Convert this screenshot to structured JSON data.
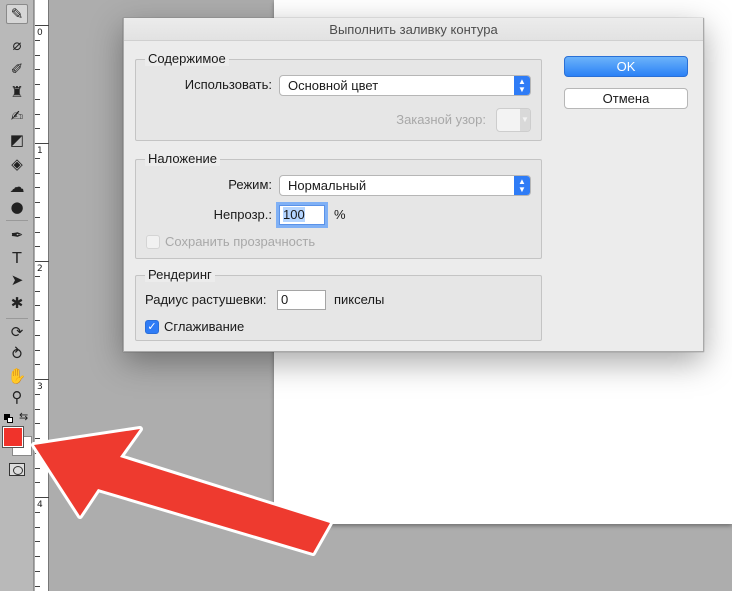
{
  "dialog": {
    "title": "Выполнить заливку контура",
    "content_group": {
      "legend": "Содержимое",
      "use_label": "Использовать:",
      "use_value": "Основной цвет",
      "pattern_label": "Заказной узор:"
    },
    "blending_group": {
      "legend": "Наложение",
      "mode_label": "Режим:",
      "mode_value": "Нормальный",
      "opacity_label": "Непрозр.:",
      "opacity_value": "100",
      "opacity_unit": "%",
      "preserve_transparency_label": "Сохранить прозрачность"
    },
    "rendering_group": {
      "legend": "Рендеринг",
      "feather_label": "Радиус растушевки:",
      "feather_value": "0",
      "feather_unit": "пикселы",
      "antialias_label": "Сглаживание",
      "antialias_checked": true
    },
    "ok_label": "OK",
    "cancel_label": "Отмена"
  },
  "ruler": {
    "labels": [
      "0",
      "1",
      "2",
      "3",
      "4"
    ]
  },
  "colors": {
    "foreground": "#f0332b",
    "background": "#ffffff",
    "accent": "#2f7cf6",
    "annotation_arrow": "#ee3a2f"
  },
  "tools": [
    "eyedropper-icon",
    "spot-healing-brush-icon",
    "brush-icon",
    "clone-stamp-icon",
    "history-brush-icon",
    "eraser-icon",
    "paint-bucket-icon",
    "blur-icon",
    "dodge-icon",
    "pen-icon",
    "type-icon",
    "path-selection-icon",
    "custom-shape-icon",
    "3d-rotate-icon",
    "3d-orbit-icon",
    "hand-icon",
    "zoom-icon"
  ]
}
